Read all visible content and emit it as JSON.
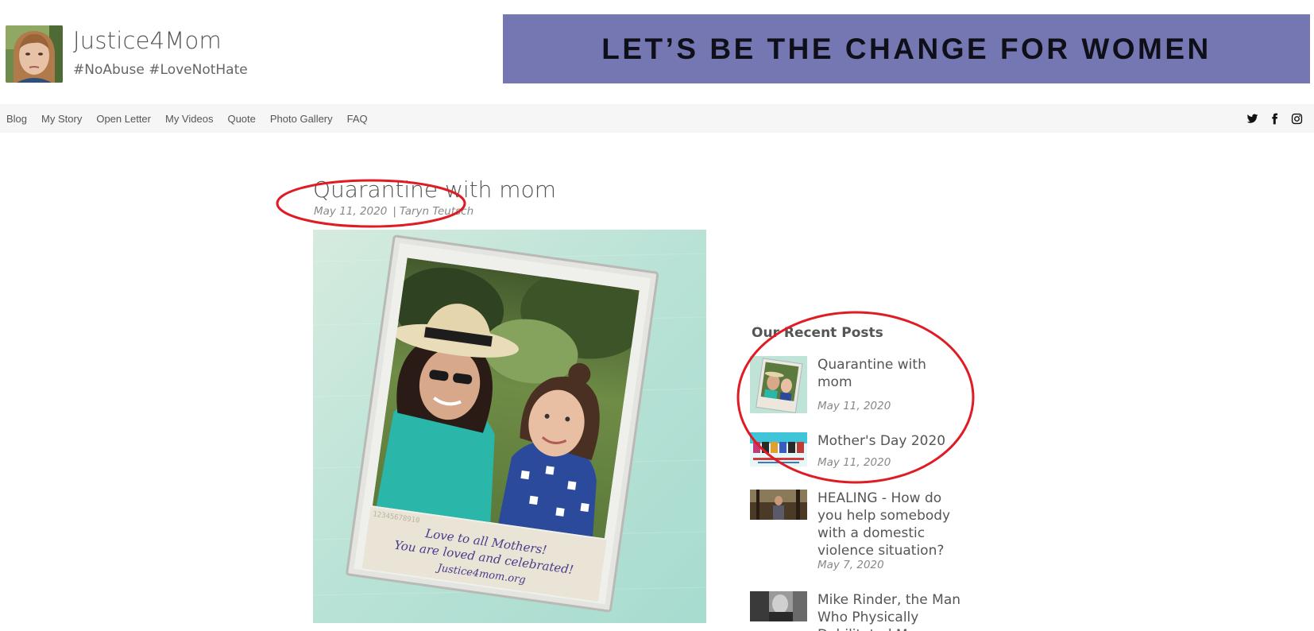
{
  "header": {
    "site_title": "Justice4Mom",
    "tagline": "#NoAbuse #LoveNotHate",
    "banner_text": "LET’S BE THE CHANGE FOR WOMEN",
    "banner_color": "#7577b2"
  },
  "nav": {
    "items": [
      "Blog",
      "My Story",
      "Open Letter",
      "My Videos",
      "Quote",
      "Photo Gallery",
      "FAQ"
    ],
    "social_icons": [
      "twitter-icon",
      "facebook-icon",
      "instagram-icon"
    ]
  },
  "post": {
    "title": "Quarantine with mom",
    "date": "May 11, 2020",
    "separator": "|",
    "author": "Taryn Teutsch",
    "image_caption_lines": [
      "Love to all Mothers!",
      "You are loved and celebrated!",
      "Justice4mom.org"
    ]
  },
  "sidebar": {
    "heading": "Our Recent Posts",
    "posts": [
      {
        "title": "Quarantine with mom",
        "date": "May 11, 2020"
      },
      {
        "title": "Mother's Day 2020",
        "date": "May 11, 2020"
      },
      {
        "title": "HEALING - How do you help somebody with a domestic violence situation?",
        "date": "May 7, 2020"
      },
      {
        "title": "Mike Rinder, the Man Who Physically Debilitated My Mother",
        "date": ""
      }
    ]
  },
  "annotation_color": "#e01b24"
}
